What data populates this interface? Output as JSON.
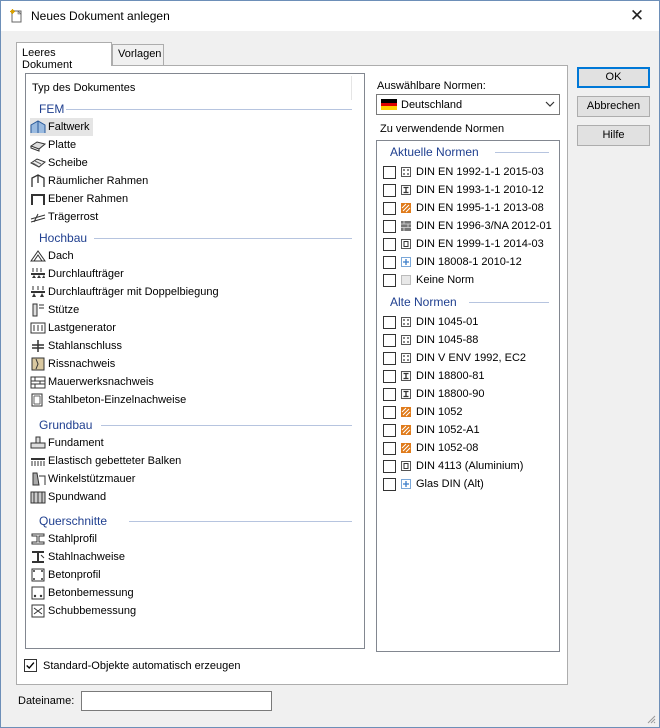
{
  "window": {
    "title": "Neues Dokument anlegen",
    "close_glyph": "✕"
  },
  "tabs": [
    {
      "label": "Leeres Dokument"
    },
    {
      "label": "Vorlagen"
    }
  ],
  "doc_types": {
    "header": "Typ des Dokumentes",
    "groups": [
      {
        "title": "FEM",
        "items": [
          {
            "label": "Faltwerk",
            "icon": "folded-plate-icon",
            "selected": true
          },
          {
            "label": "Platte",
            "icon": "plate-icon"
          },
          {
            "label": "Scheibe",
            "icon": "shell-icon"
          },
          {
            "label": "Räumlicher Rahmen",
            "icon": "spatial-frame-icon"
          },
          {
            "label": "Ebener Rahmen",
            "icon": "plane-frame-icon"
          },
          {
            "label": "Trägerrost",
            "icon": "girder-grid-icon"
          }
        ]
      },
      {
        "title": "Hochbau",
        "items": [
          {
            "label": "Dach",
            "icon": "roof-icon"
          },
          {
            "label": "Durchlaufträger",
            "icon": "continuous-beam-icon"
          },
          {
            "label": "Durchlaufträger mit Doppelbiegung",
            "icon": "biaxial-beam-icon"
          },
          {
            "label": "Stütze",
            "icon": "column-icon"
          },
          {
            "label": "Lastgenerator",
            "icon": "load-generator-icon"
          },
          {
            "label": "Stahlanschluss",
            "icon": "steel-connection-icon"
          },
          {
            "label": "Rissnachweis",
            "icon": "crack-check-icon"
          },
          {
            "label": "Mauerwerksnachweis",
            "icon": "masonry-icon"
          },
          {
            "label": "Stahlbeton-Einzelnachweise",
            "icon": "reinforced-concrete-icon"
          }
        ]
      },
      {
        "title": "Grundbau",
        "items": [
          {
            "label": "Fundament",
            "icon": "foundation-icon"
          },
          {
            "label": "Elastisch gebetteter Balken",
            "icon": "elastic-beam-icon"
          },
          {
            "label": "Winkelstützmauer",
            "icon": "retaining-wall-icon"
          },
          {
            "label": "Spundwand",
            "icon": "sheet-pile-icon"
          }
        ]
      },
      {
        "title": "Querschnitte",
        "items": [
          {
            "label": "Stahlprofil",
            "icon": "steel-profile-icon"
          },
          {
            "label": "Stahlnachweise",
            "icon": "steel-check-icon"
          },
          {
            "label": "Betonprofil",
            "icon": "concrete-profile-icon"
          },
          {
            "label": "Betonbemessung",
            "icon": "concrete-design-icon"
          },
          {
            "label": "Schubbemessung",
            "icon": "shear-design-icon"
          }
        ]
      }
    ]
  },
  "norms": {
    "selectable_label": "Auswählbare Normen:",
    "country": {
      "value": "Deutschland",
      "flag": "german-flag-icon"
    },
    "to_use_label": "Zu verwendende Normen",
    "groups": [
      {
        "title": "Aktuelle Normen",
        "items": [
          {
            "label": "DIN EN 1992-1-1 2015-03",
            "icon": "concrete-norm-icon"
          },
          {
            "label": "DIN EN 1993-1-1 2010-12",
            "icon": "steel-norm-icon"
          },
          {
            "label": "DIN EN 1995-1-1 2013-08",
            "icon": "timber-norm-icon"
          },
          {
            "label": "DIN EN 1996-3/NA 2012-01",
            "icon": "masonry-norm-icon"
          },
          {
            "label": "DIN EN 1999-1-1 2014-03",
            "icon": "aluminium-norm-icon"
          },
          {
            "label": "DIN 18008-1 2010-12",
            "icon": "glass-norm-icon"
          },
          {
            "label": "Keine Norm",
            "icon": "no-norm-icon"
          }
        ]
      },
      {
        "title": "Alte Normen",
        "items": [
          {
            "label": "DIN 1045-01",
            "icon": "concrete-norm-icon"
          },
          {
            "label": "DIN 1045-88",
            "icon": "concrete-norm-icon"
          },
          {
            "label": "DIN V ENV 1992, EC2",
            "icon": "concrete-norm-icon"
          },
          {
            "label": "DIN 18800-81",
            "icon": "steel-norm-icon"
          },
          {
            "label": "DIN 18800-90",
            "icon": "steel-norm-icon"
          },
          {
            "label": "DIN 1052",
            "icon": "timber-norm-icon"
          },
          {
            "label": "DIN 1052-A1",
            "icon": "timber-norm-icon"
          },
          {
            "label": "DIN 1052-08",
            "icon": "timber-norm-icon"
          },
          {
            "label": "DIN 4113 (Aluminium)",
            "icon": "aluminium-norm-icon"
          },
          {
            "label": "Glas DIN (Alt)",
            "icon": "glass-norm-icon"
          }
        ]
      }
    ]
  },
  "buttons": {
    "ok": "OK",
    "cancel": "Abbrechen",
    "help": "Hilfe"
  },
  "auto_objects": {
    "label": "Standard-Objekte automatisch erzeugen",
    "checked": true
  },
  "filename": {
    "label": "Dateiname:",
    "value": ""
  },
  "colors": {
    "accent": "#0078d7",
    "group_title": "#1f3f8f",
    "selection": "#e5e5e5"
  }
}
